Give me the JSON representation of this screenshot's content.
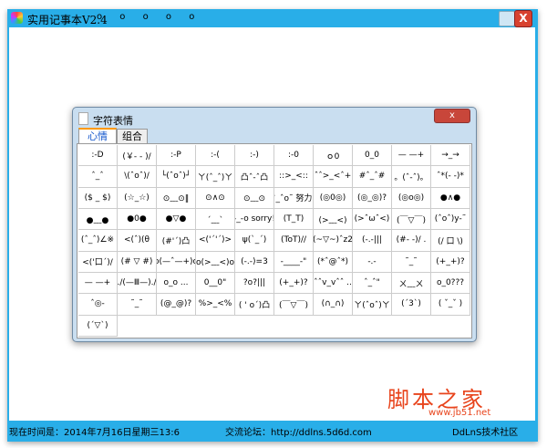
{
  "window": {
    "title": "实用记事本V2.4",
    "title_dots": "o o o o o",
    "close_label": "X"
  },
  "statusbar": {
    "time": "现在时间是：2014年7月16日星期三13:6",
    "forum": "交流论坛：http://ddlns.5d6d.com",
    "community": "DdLnS技术社区"
  },
  "watermark": {
    "brand": "脚本之家",
    "url": "www.jb51.net"
  },
  "dialog": {
    "title": "字符表情",
    "close_label": "x",
    "tabs": [
      {
        "label": "心情"
      },
      {
        "label": "组合"
      }
    ],
    "emoticons": [
      ":-D",
      "(￥- - )/",
      ":-P",
      ":-(",
      ":-)",
      ":-0",
      "ｏ0",
      "0_0",
      "— —+",
      "→_→",
      "ˆ_ˆ",
      "\\(ˆoˆ)/",
      "└(ˆoˆ)┘",
      "ㄚ(ˆ_ˆ)ㄚ",
      "凸ˆ-ˆ凸",
      "::>_<::",
      "ˆˆ>_<ˆ+",
      "#ˆ_ˆ#",
      "。(ˆ-ˆ)。",
      "ˆ*(- -)*",
      "($ _ $)",
      "(☆_☆)",
      "⊙﹏⊙‖",
      "⊙∧⊙",
      "⊙﹏⊙",
      "ˆ_ˆo˜ 努力!",
      "(◎0◎)",
      "(◎_◎)?",
      "(◎o◎)",
      "●∧●",
      "●﹏●",
      "●0●",
      "●▽●",
      "ˊ﹏ˋ",
      "-_-o sorry!",
      "(T_T)",
      "(>﹏<)",
      "(>ˆωˆ<)",
      "(￣▽￣)",
      "(ˆoˆ)y-˜",
      "(ˆ_ˆ)∠※",
      "<(ˆ)(θ",
      "(#'ˊ)凸",
      "<('ˊ'ˊ)>",
      "ψ(ˋ_ˊ)",
      "(ToT)//",
      "(~▽~)ˆz2",
      "(-.-|||",
      "(#- -)/ .",
      "(/ 口 \\)",
      "<('口ˊ)/",
      "(# ▽ #)",
      "o(—ˆ—+)o",
      "o(>﹏<)o",
      "(-.-)=3",
      "-____-\"",
      "(*ˆ@ˆ*)",
      "-.-",
      "˜_˜",
      "(+_+)?",
      "— —+",
      "./(—Ⅲ—)./",
      "o_o ...",
      "0__0\"",
      "?o?|||",
      "(+_+)?",
      "ˆˆv_vˆˆ ..",
      "ˆ_ˆ\"",
      "ㄨ﹏ㄨ",
      "o_0???",
      "ˆ◎-",
      "˜_˜",
      "(@_@)?",
      "%>_<%",
      "( ' oˊ)凸",
      "(￣▽￣)",
      "(∩_∩)",
      "ㄚ(ˆoˆ)ㄚ",
      "(ˊ3ˋ)",
      "( ˇ_ˇ )",
      "(ˊ▽ˋ)"
    ]
  }
}
